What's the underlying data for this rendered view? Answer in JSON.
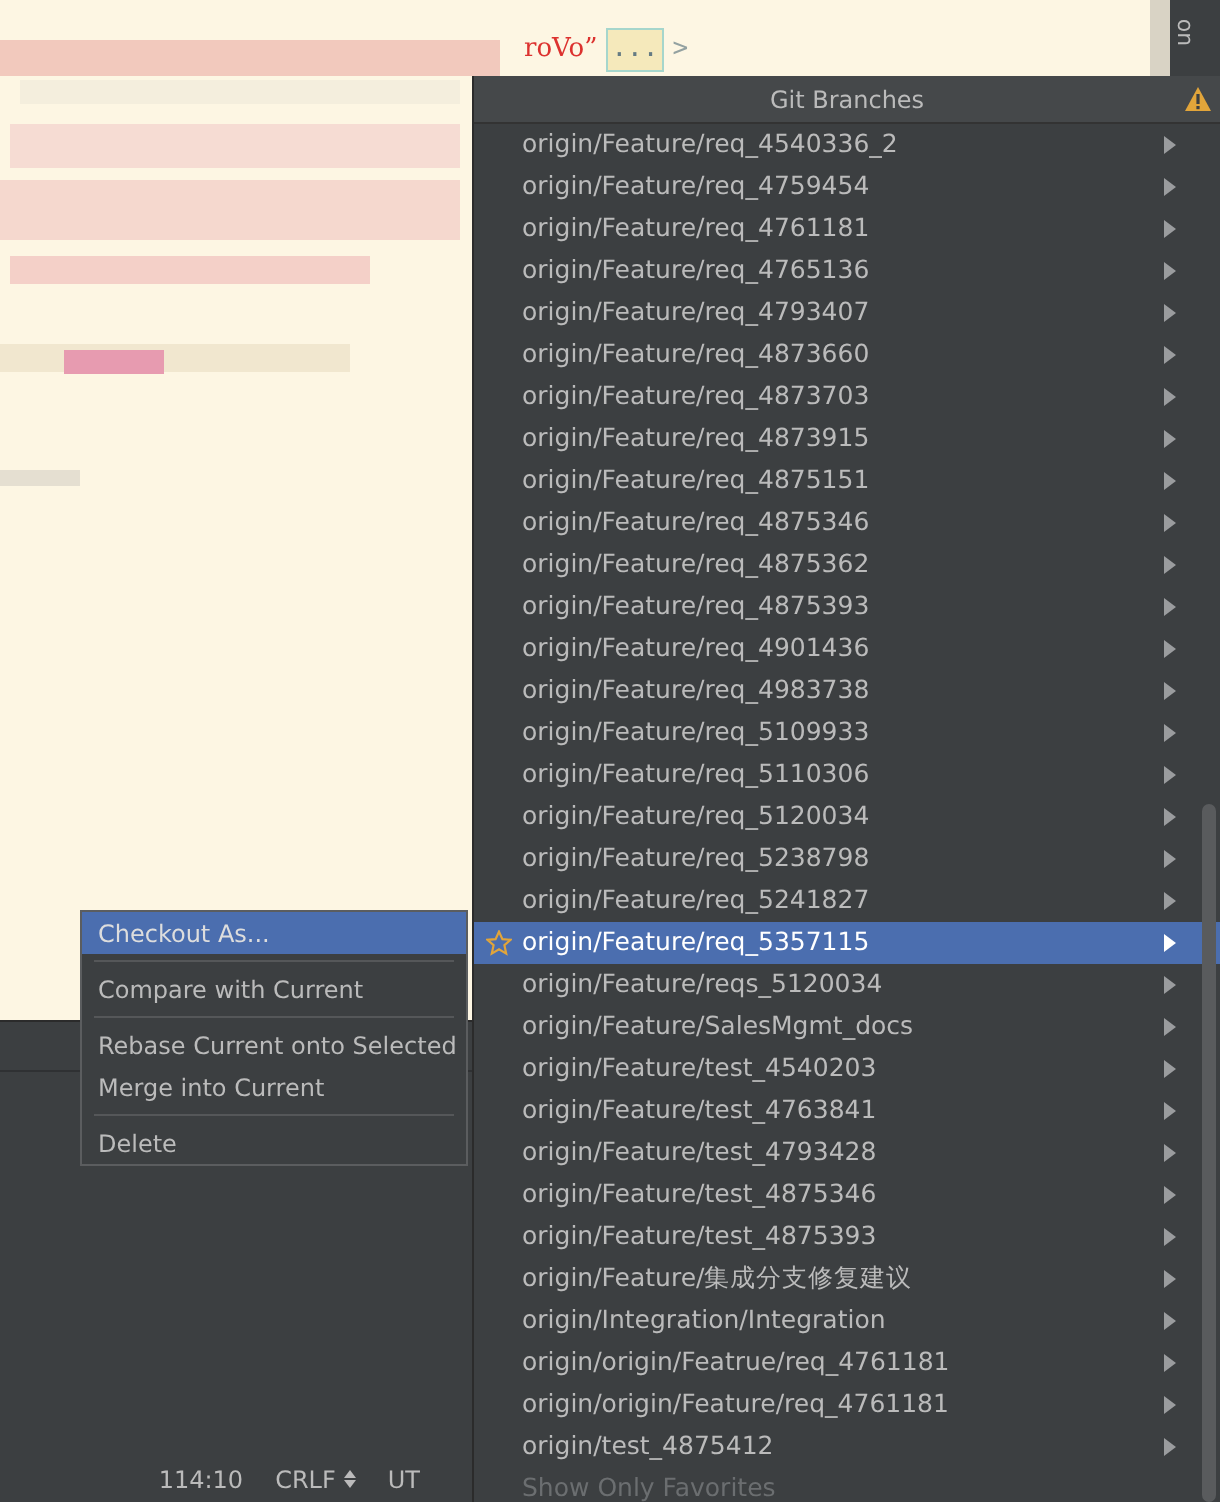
{
  "editor": {
    "code_fragment": "roVo”",
    "fold_marker": "...",
    "fold_arrow": ">",
    "side_tab": "on"
  },
  "context_menu": {
    "groups": [
      [
        {
          "label": "Checkout As...",
          "selected": true
        }
      ],
      [
        {
          "label": "Compare with Current",
          "selected": false
        }
      ],
      [
        {
          "label": "Rebase Current onto Selected",
          "selected": false
        },
        {
          "label": "Merge into Current",
          "selected": false
        }
      ],
      [
        {
          "label": "Delete",
          "selected": false
        }
      ]
    ]
  },
  "status_bar": {
    "position": "114:10",
    "line_separator": "CRLF",
    "encoding": "UT"
  },
  "git_branches": {
    "title": "Git Branches",
    "branches": [
      {
        "name": "origin/Feature/req_4540336_2",
        "selected": false,
        "favorite": false
      },
      {
        "name": "origin/Feature/req_4759454",
        "selected": false,
        "favorite": false
      },
      {
        "name": "origin/Feature/req_4761181",
        "selected": false,
        "favorite": false
      },
      {
        "name": "origin/Feature/req_4765136",
        "selected": false,
        "favorite": false
      },
      {
        "name": "origin/Feature/req_4793407",
        "selected": false,
        "favorite": false
      },
      {
        "name": "origin/Feature/req_4873660",
        "selected": false,
        "favorite": false
      },
      {
        "name": "origin/Feature/req_4873703",
        "selected": false,
        "favorite": false
      },
      {
        "name": "origin/Feature/req_4873915",
        "selected": false,
        "favorite": false
      },
      {
        "name": "origin/Feature/req_4875151",
        "selected": false,
        "favorite": false
      },
      {
        "name": "origin/Feature/req_4875346",
        "selected": false,
        "favorite": false
      },
      {
        "name": "origin/Feature/req_4875362",
        "selected": false,
        "favorite": false
      },
      {
        "name": "origin/Feature/req_4875393",
        "selected": false,
        "favorite": false
      },
      {
        "name": "origin/Feature/req_4901436",
        "selected": false,
        "favorite": false
      },
      {
        "name": "origin/Feature/req_4983738",
        "selected": false,
        "favorite": false
      },
      {
        "name": "origin/Feature/req_5109933",
        "selected": false,
        "favorite": false
      },
      {
        "name": "origin/Feature/req_5110306",
        "selected": false,
        "favorite": false
      },
      {
        "name": "origin/Feature/req_5120034",
        "selected": false,
        "favorite": false
      },
      {
        "name": "origin/Feature/req_5238798",
        "selected": false,
        "favorite": false
      },
      {
        "name": "origin/Feature/req_5241827",
        "selected": false,
        "favorite": false
      },
      {
        "name": "origin/Feature/req_5357115",
        "selected": true,
        "favorite": true
      },
      {
        "name": "origin/Feature/reqs_5120034",
        "selected": false,
        "favorite": false
      },
      {
        "name": "origin/Feature/SalesMgmt_docs",
        "selected": false,
        "favorite": false
      },
      {
        "name": "origin/Feature/test_4540203",
        "selected": false,
        "favorite": false
      },
      {
        "name": "origin/Feature/test_4763841",
        "selected": false,
        "favorite": false
      },
      {
        "name": "origin/Feature/test_4793428",
        "selected": false,
        "favorite": false
      },
      {
        "name": "origin/Feature/test_4875346",
        "selected": false,
        "favorite": false
      },
      {
        "name": "origin/Feature/test_4875393",
        "selected": false,
        "favorite": false
      },
      {
        "name": "origin/Feature/集成分支修复建议",
        "selected": false,
        "favorite": false
      },
      {
        "name": "origin/Integration/Integration",
        "selected": false,
        "favorite": false
      },
      {
        "name": "origin/origin/Featrue/req_4761181",
        "selected": false,
        "favorite": false
      },
      {
        "name": "origin/origin/Feature/req_4761181",
        "selected": false,
        "favorite": false
      },
      {
        "name": "origin/test_4875412",
        "selected": false,
        "favorite": false
      }
    ],
    "footer": {
      "label": "Show Only Favorites",
      "disabled": true
    }
  }
}
